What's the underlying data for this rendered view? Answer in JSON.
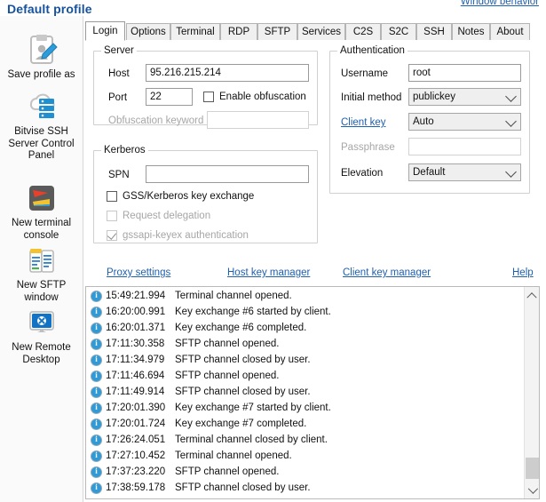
{
  "header": {
    "title": "Default profile",
    "window_behavior_link": "Window behavior"
  },
  "sidebar": {
    "items": [
      {
        "label": "Save profile as",
        "icon": "save-profile-icon"
      },
      {
        "label": "Bitvise SSH Server Control Panel",
        "icon": "server-cloud-icon"
      },
      {
        "label": "New terminal console",
        "icon": "terminal-console-icon"
      },
      {
        "label": "New SFTP window",
        "icon": "sftp-window-icon"
      },
      {
        "label": "New Remote Desktop",
        "icon": "remote-desktop-icon"
      }
    ]
  },
  "tabs": [
    {
      "label": "Login",
      "active": true
    },
    {
      "label": "Options",
      "active": false
    },
    {
      "label": "Terminal",
      "active": false
    },
    {
      "label": "RDP",
      "active": false
    },
    {
      "label": "SFTP",
      "active": false
    },
    {
      "label": "Services",
      "active": false
    },
    {
      "label": "C2S",
      "active": false
    },
    {
      "label": "S2C",
      "active": false
    },
    {
      "label": "SSH",
      "active": false
    },
    {
      "label": "Notes",
      "active": false
    },
    {
      "label": "About",
      "active": false
    }
  ],
  "server": {
    "group_title": "Server",
    "host_label": "Host",
    "host_value": "95.216.215.214",
    "port_label": "Port",
    "port_value": "22",
    "enable_obfuscation_label": "Enable obfuscation",
    "enable_obfuscation_checked": false,
    "obfuscation_keyword_label": "Obfuscation keyword",
    "obfuscation_keyword_value": ""
  },
  "kerberos": {
    "group_title": "Kerberos",
    "spn_label": "SPN",
    "spn_value": "",
    "gss_label": "GSS/Kerberos key exchange",
    "gss_checked": false,
    "delegation_label": "Request delegation",
    "delegation_checked": false,
    "gssapi_keyex_label": "gssapi-keyex authentication",
    "gssapi_keyex_checked": true
  },
  "authentication": {
    "group_title": "Authentication",
    "username_label": "Username",
    "username_value": "root",
    "initial_method_label": "Initial method",
    "initial_method_value": "publickey",
    "client_key_label": "Client key",
    "client_key_value": "Auto",
    "passphrase_label": "Passphrase",
    "passphrase_value": "",
    "elevation_label": "Elevation",
    "elevation_value": "Default"
  },
  "links": {
    "proxy_settings": "Proxy settings",
    "host_key_manager": "Host key manager",
    "client_key_manager": "Client key manager",
    "help": "Help"
  },
  "log": {
    "entries": [
      {
        "time": "15:49:21.994",
        "message": "Terminal channel opened."
      },
      {
        "time": "16:20:00.991",
        "message": "Key exchange #6 started by client."
      },
      {
        "time": "16:20:01.371",
        "message": "Key exchange #6 completed."
      },
      {
        "time": "17:11:30.358",
        "message": "SFTP channel opened."
      },
      {
        "time": "17:11:34.979",
        "message": "SFTP channel closed by user."
      },
      {
        "time": "17:11:46.694",
        "message": "SFTP channel opened."
      },
      {
        "time": "17:11:49.914",
        "message": "SFTP channel closed by user."
      },
      {
        "time": "17:20:01.390",
        "message": "Key exchange #7 started by client."
      },
      {
        "time": "17:20:01.724",
        "message": "Key exchange #7 completed."
      },
      {
        "time": "17:26:24.051",
        "message": "Terminal channel closed by client."
      },
      {
        "time": "17:27:10.452",
        "message": "Terminal channel opened."
      },
      {
        "time": "17:37:23.220",
        "message": "SFTP channel opened."
      },
      {
        "time": "17:38:59.178",
        "message": "SFTP channel closed by user."
      }
    ]
  },
  "colors": {
    "title_blue": "#16529e",
    "link_blue": "#2060b0",
    "info_icon_blue": "#2f9ad6",
    "panel_bg": "#ffffff",
    "sidebar_bg": "#fafafa"
  }
}
